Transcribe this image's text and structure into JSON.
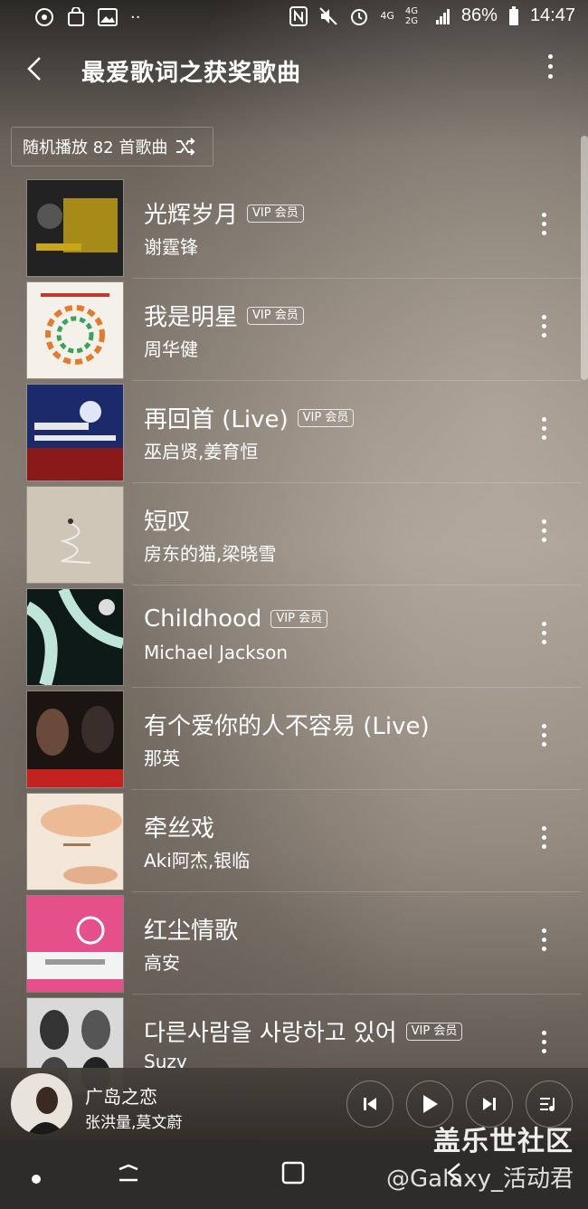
{
  "status_bar": {
    "network_4g": "4G",
    "network_4g2g": "4G 2G",
    "battery": "86%",
    "time": "14:47"
  },
  "header": {
    "title": "最爱歌词之获奖歌曲"
  },
  "shuffle": {
    "label": "随机播放 82 首歌曲"
  },
  "songs": [
    {
      "title": "光辉岁月",
      "artist": "谢霆锋",
      "vip": "VIP 会员",
      "cover_color": "#2a2a2a"
    },
    {
      "title": "我是明星",
      "artist": "周华健",
      "vip": "VIP 会员",
      "cover_color": "#f4f1ea"
    },
    {
      "title": "再回首 (Live)",
      "artist": "巫启贤,姜育恒",
      "vip": "VIP 会员",
      "cover_color": "#1a2a6a"
    },
    {
      "title": "短叹",
      "artist": "房东的猫,梁晓雪",
      "vip": "",
      "cover_color": "#cfc6b8"
    },
    {
      "title": "Childhood",
      "artist": "Michael Jackson",
      "vip": "VIP 会员",
      "cover_color": "#3b6b64"
    },
    {
      "title": "有个爱你的人不容易 (Live)",
      "artist": "那英",
      "vip": "",
      "cover_color": "#1c1410"
    },
    {
      "title": "牵丝戏",
      "artist": "Aki阿杰,银临",
      "vip": "",
      "cover_color": "#f3e7da"
    },
    {
      "title": "红尘情歌",
      "artist": "高安",
      "vip": "",
      "cover_color": "#e5508a"
    },
    {
      "title": "다른사람을 사랑하고 있어",
      "artist": "Suzy",
      "vip": "VIP 会员",
      "cover_color": "#d9d9d9"
    }
  ],
  "mini_player": {
    "title": "广岛之恋",
    "artist": "张洪量,莫文蔚"
  },
  "watermark": {
    "main": "盖乐世社区",
    "sub": "@Galaxy_活动君"
  }
}
